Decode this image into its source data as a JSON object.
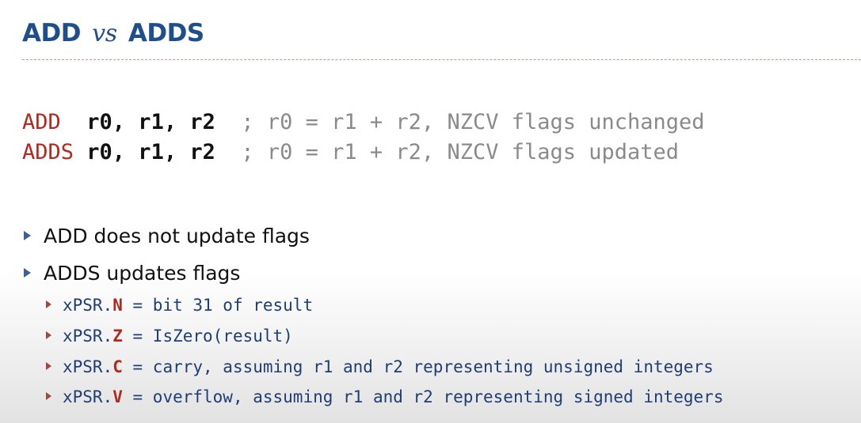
{
  "title": {
    "part1": "ADD",
    "vs": "vs",
    "part2": "ADDS"
  },
  "code_lines": [
    {
      "mnemonic": "ADD ",
      "operands": " r0, r1, r2",
      "comment": "  ; r0 = r1 + r2, NZCV flags unchanged"
    },
    {
      "mnemonic": "ADDS",
      "operands": " r0, r1, r2",
      "comment": "  ; r0 = r1 + r2, NZCV flags updated"
    }
  ],
  "bullets": [
    "ADD does not update flags",
    "ADDS updates flags"
  ],
  "sub_bullets": [
    {
      "prefix": "xPSR.",
      "flag": "N",
      "text": " = bit 31 of result"
    },
    {
      "prefix": "xPSR.",
      "flag": "Z",
      "text": " = IsZero(result)"
    },
    {
      "prefix": "xPSR.",
      "flag": "C",
      "text": " = carry, assuming r1 and r2 representing unsigned integers"
    },
    {
      "prefix": "xPSR.",
      "flag": "V",
      "text": " = overflow, assuming r1 and r2 representing signed integers"
    }
  ],
  "colors": {
    "title": "#1f4e8c",
    "mnemonic": "#b22a1f",
    "comment": "#8a8a8a",
    "flag": "#b22a1f",
    "sub_text": "#1f3e73"
  }
}
